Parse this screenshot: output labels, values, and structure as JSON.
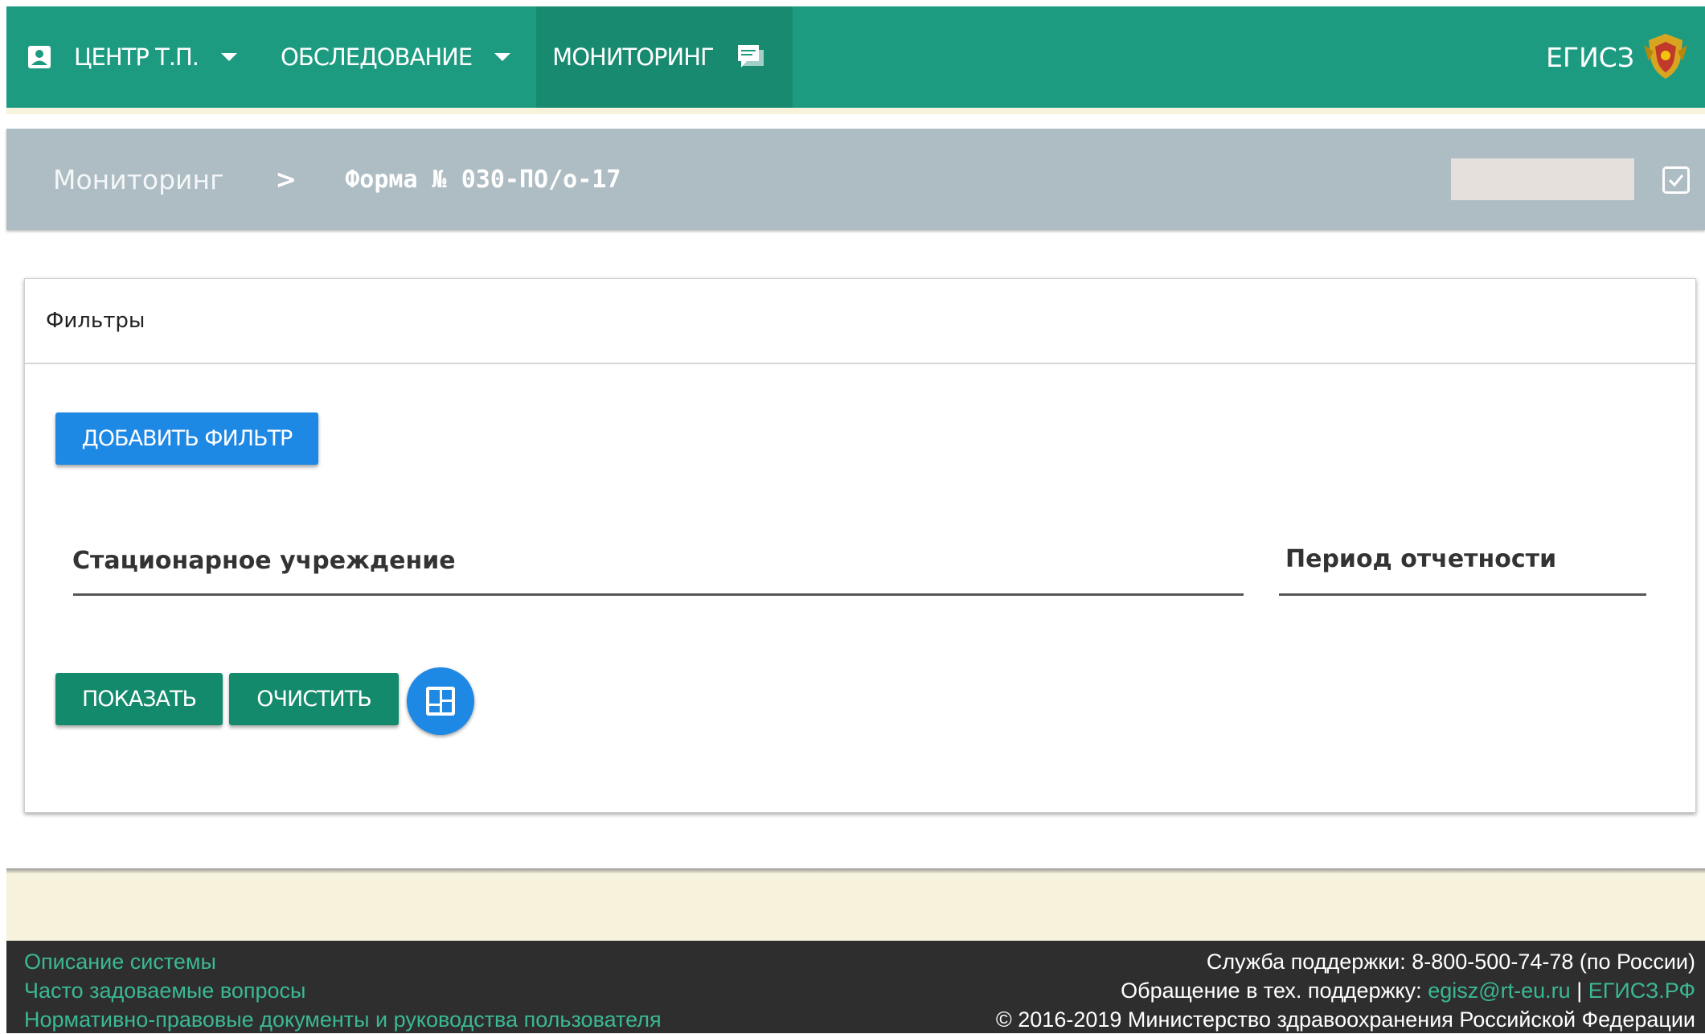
{
  "nav": {
    "items": [
      {
        "label": "ЦЕНТР Т.П."
      },
      {
        "label": "ОБСЛЕДОВАНИЕ"
      },
      {
        "label": "МОНИТОРИНГ"
      }
    ],
    "brand": "ЕГИСЗ",
    "icons": [
      "person-icon",
      "caret-down-icon",
      "chat-icon",
      "emblem-icon"
    ]
  },
  "breadcrumb": {
    "root": "Мониторинг",
    "separator": ">",
    "current": "Форма № 030-ПО/о-17"
  },
  "filters": {
    "title": "Фильтры",
    "add_button": "ДОБАВИТЬ ФИЛЬТР",
    "field_institution": "Стационарное учреждение",
    "field_period": "Период отчетности",
    "show_button": "ПОКАЗАТЬ",
    "clear_button": "ОЧИСТИТЬ"
  },
  "footer": {
    "links": [
      "Описание системы",
      "Часто задоваемые вопросы",
      "Нормативно-правовые документы и руководства пользователя"
    ],
    "support": "Служба поддержки: 8-800-500-74-78 (по России)",
    "contact_prefix": "Обращение в тех. поддержку:",
    "contact_email": "egisz@rt-eu.ru",
    "contact_sep": "|",
    "contact_site": "ЕГИСЗ.РФ",
    "copyright": "© 2016-2019 Министерство здравоохранения Российской Федерации"
  },
  "colors": {
    "nav": "#1d9b80",
    "crumb": "#aebcc3",
    "primary": "#1e88e5",
    "action": "#138a6c",
    "footer": "#2e2e2e",
    "link": "#3bb894"
  }
}
